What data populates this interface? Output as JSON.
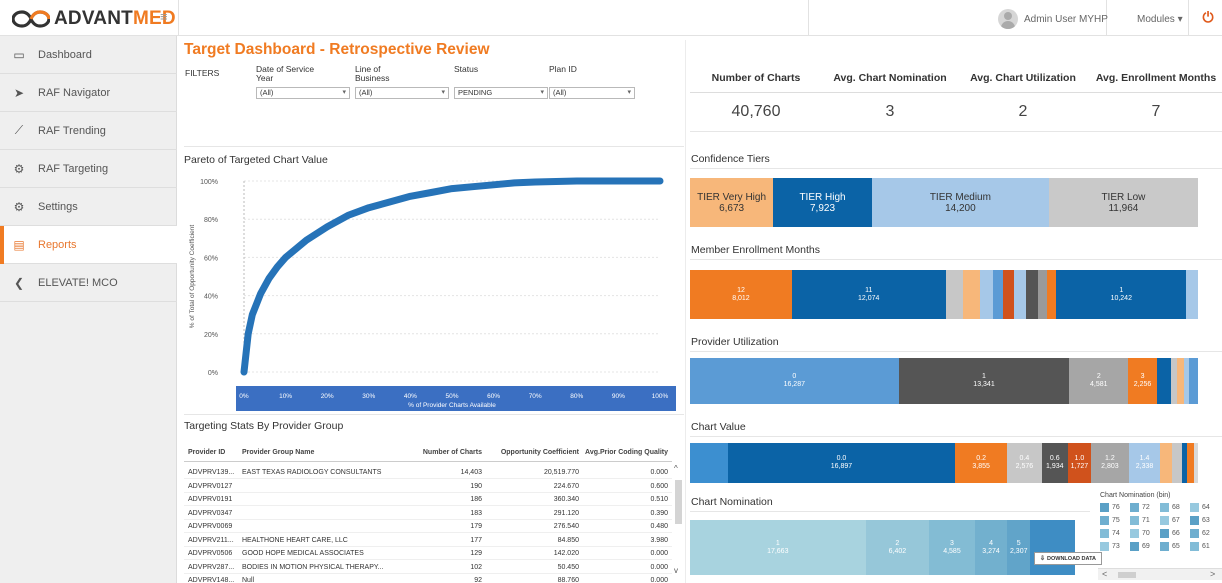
{
  "app": {
    "logo": {
      "prefix": "ADVANT",
      "accent": "MED"
    },
    "user": "Admin User MYHP",
    "modules": "Modules ▾"
  },
  "sidebar": {
    "items": [
      {
        "label": "Dashboard",
        "icon": "monitor-icon"
      },
      {
        "label": "RAF Navigator",
        "icon": "navigation-arrow-icon"
      },
      {
        "label": "RAF Trending",
        "icon": "trend-chart-icon"
      },
      {
        "label": "RAF Targeting",
        "icon": "target-gear-icon"
      },
      {
        "label": "Settings",
        "icon": "gears-icon"
      },
      {
        "label": "Reports",
        "icon": "document-icon",
        "active": true
      },
      {
        "label": "ELEVATE! MCO",
        "icon": "chevron-left-icon"
      }
    ]
  },
  "page": {
    "title": "Target Dashboard - Retrospective Review",
    "filters_label": "FILTERS",
    "filters": [
      {
        "label": "Date of Service Year",
        "value": "(All)"
      },
      {
        "label": "Line of Business",
        "value": "(All)"
      },
      {
        "label": "Status",
        "value": "PENDING"
      },
      {
        "label": "Plan ID",
        "value": "(All)"
      }
    ]
  },
  "kpis": [
    {
      "label": "Number of Charts",
      "value": "40,760"
    },
    {
      "label": "Avg. Chart Nomination",
      "value": "3"
    },
    {
      "label": "Avg. Chart Utilization",
      "value": "2"
    },
    {
      "label": "Avg. Enrollment Months",
      "value": "7"
    }
  ],
  "sections": {
    "pareto": "Pareto of Targeted Chart Value",
    "confidence": "Confidence Tiers",
    "enrollment": "Member Enrollment Months",
    "provider_util": "Provider Utilization",
    "chart_value": "Chart Value",
    "chart_nomination": "Chart Nomination",
    "targeting_stats": "Targeting Stats By Provider Group"
  },
  "colors": {
    "accent": "#f07b22",
    "blue_dark": "#0b63a6",
    "blue_mid": "#5b9bd5",
    "blue_light": "#a6c8e8",
    "gray": "#c7c7c7",
    "pareto_line": "#2673b8",
    "axis_band": "#3b6fc2"
  },
  "chart_data": {
    "type": "line",
    "title": "Pareto of Targeted Chart Value",
    "xlabel": "% of Provider Charts Available",
    "ylabel": "% of Total of Opportunity Coefficient",
    "x_ticks": [
      "0%",
      "10%",
      "20%",
      "30%",
      "40%",
      "50%",
      "60%",
      "70%",
      "80%",
      "90%",
      "100%"
    ],
    "y_ticks": [
      "0%",
      "20%",
      "40%",
      "60%",
      "80%",
      "100%"
    ],
    "xlim": [
      0,
      100
    ],
    "ylim": [
      0,
      100
    ],
    "x": [
      0,
      1,
      2,
      4,
      6,
      8,
      10,
      15,
      20,
      25,
      30,
      35,
      40,
      45,
      50,
      55,
      60,
      65,
      70,
      80,
      90,
      100
    ],
    "y": [
      0,
      20,
      30,
      41,
      49,
      55,
      60,
      69,
      76,
      82,
      86,
      89,
      92,
      94,
      96,
      97,
      98,
      99,
      99.5,
      100,
      100,
      100
    ]
  },
  "confidence_tiers": [
    {
      "label": "TIER Very High",
      "value": "6,673",
      "color": "#f7b77a",
      "dark": true,
      "w": 6673
    },
    {
      "label": "TIER High",
      "value": "7,923",
      "color": "#0b63a6",
      "dark": false,
      "w": 7923
    },
    {
      "label": "TIER Medium",
      "value": "14,200",
      "color": "#a6c8e8",
      "dark": true,
      "w": 14200
    },
    {
      "label": "TIER Low",
      "value": "11,964",
      "color": "#c9c9c9",
      "dark": true,
      "w": 11964
    }
  ],
  "enrollment_months": [
    {
      "label": "12",
      "value": "8,012",
      "color": "#f07b22",
      "w": 8012
    },
    {
      "label": "11",
      "value": "12,074",
      "color": "#0b63a6",
      "w": 12074
    },
    {
      "label": "",
      "value": "",
      "color": "#c7c7c7",
      "w": 1400
    },
    {
      "label": "",
      "value": "",
      "color": "#f7b77a",
      "w": 1300
    },
    {
      "label": "",
      "value": "",
      "color": "#a6c8e8",
      "w": 1000
    },
    {
      "label": "",
      "value": "",
      "color": "#5b9bd5",
      "w": 800
    },
    {
      "label": "",
      "value": "",
      "color": "#d0521c",
      "w": 900
    },
    {
      "label": "",
      "value": "",
      "color": "#a6c8e8",
      "w": 900
    },
    {
      "label": "",
      "value": "",
      "color": "#555555",
      "w": 1000
    },
    {
      "label": "",
      "value": "",
      "color": "#9a9a9a",
      "w": 700
    },
    {
      "label": "",
      "value": "",
      "color": "#f07b22",
      "w": 700
    },
    {
      "label": "1",
      "value": "10,242",
      "color": "#0b63a6",
      "w": 10242
    },
    {
      "label": "",
      "value": "",
      "color": "#a6c8e8",
      "w": 900
    }
  ],
  "provider_utilization": [
    {
      "label": "0",
      "value": "16,287",
      "color": "#5b9bd5",
      "w": 16287
    },
    {
      "label": "1",
      "value": "13,341",
      "color": "#555555",
      "w": 13341
    },
    {
      "label": "2",
      "value": "4,581",
      "color": "#a6a6a6",
      "w": 4581
    },
    {
      "label": "3",
      "value": "2,256",
      "color": "#f07b22",
      "w": 2256
    },
    {
      "label": "",
      "value": "",
      "color": "#0b63a6",
      "w": 1100
    },
    {
      "label": "",
      "value": "",
      "color": "#c7c7c7",
      "w": 500
    },
    {
      "label": "",
      "value": "",
      "color": "#f7b77a",
      "w": 500
    },
    {
      "label": "",
      "value": "",
      "color": "#a6c8e8",
      "w": 400
    },
    {
      "label": "",
      "value": "",
      "color": "#5b9bd5",
      "w": 700
    }
  ],
  "chart_value": [
    {
      "label": "",
      "value": "",
      "color": "#3c8fd0",
      "w": 2800
    },
    {
      "label": "0.0",
      "value": "16,897",
      "color": "#0b63a6",
      "w": 16897
    },
    {
      "label": "0.2",
      "value": "3,855",
      "color": "#f07b22",
      "w": 3855
    },
    {
      "label": "0.4",
      "value": "2,576",
      "color": "#c7c7c7",
      "w": 2576
    },
    {
      "label": "0.6",
      "value": "1,934",
      "color": "#555555",
      "w": 1934
    },
    {
      "label": "1.0",
      "value": "1,727",
      "color": "#d0521c",
      "w": 1727
    },
    {
      "label": "1.2",
      "value": "2,803",
      "color": "#a6a6a6",
      "w": 2803
    },
    {
      "label": "1.4",
      "value": "2,338",
      "color": "#a6c8e8",
      "w": 2338
    },
    {
      "label": "",
      "value": "",
      "color": "#f7b77a",
      "w": 900
    },
    {
      "label": "",
      "value": "",
      "color": "#c7c7c7",
      "w": 700
    },
    {
      "label": "",
      "value": "",
      "color": "#0b63a6",
      "w": 400
    },
    {
      "label": "",
      "value": "",
      "color": "#f07b22",
      "w": 500
    },
    {
      "label": "",
      "value": "",
      "color": "#d9d9d9",
      "w": 300
    }
  ],
  "chart_nomination": [
    {
      "label": "1",
      "value": "17,663",
      "color": "#a8d3df",
      "w": 17663
    },
    {
      "label": "2",
      "value": "6,402",
      "color": "#96c7d9",
      "w": 6402
    },
    {
      "label": "3",
      "value": "4,585",
      "color": "#83bcd4",
      "w": 4585
    },
    {
      "label": "4",
      "value": "3,274",
      "color": "#72b0ce",
      "w": 3274
    },
    {
      "label": "5",
      "value": "2,307",
      "color": "#61a4c9",
      "w": 2307
    },
    {
      "label": "",
      "value": "",
      "color": "#3e8dc4",
      "w": 4500
    }
  ],
  "nomination_legend": {
    "title": "Chart Nomination (bin)",
    "rows": [
      [
        "76",
        "72",
        "68",
        "64"
      ],
      [
        "75",
        "71",
        "67",
        "63"
      ],
      [
        "74",
        "70",
        "66",
        "62"
      ],
      [
        "73",
        "69",
        "65",
        "61"
      ]
    ]
  },
  "table": {
    "headers": [
      "Provider ID",
      "Provider Group Name",
      "Number of Charts",
      "Opportunity Coefficient",
      "Avg.Prior Coding Quality"
    ],
    "rows": [
      [
        "ADVPRV139...",
        "EAST TEXAS RADIOLOGY CONSULTANTS",
        "14,403",
        "20,519.770",
        "0.000"
      ],
      [
        "ADVPRV0127",
        "",
        "190",
        "224.670",
        "0.600"
      ],
      [
        "ADVPRV0191",
        "",
        "186",
        "360.340",
        "0.510"
      ],
      [
        "ADVPRV0347",
        "",
        "183",
        "291.120",
        "0.390"
      ],
      [
        "ADVPRV0069",
        "",
        "179",
        "276.540",
        "0.480"
      ],
      [
        "ADVPRV211...",
        "HEALTHONE HEART CARE, LLC",
        "177",
        "84.850",
        "3.980"
      ],
      [
        "ADVPRV0506",
        "GOOD HOPE MEDICAL ASSOCIATES",
        "129",
        "142.020",
        "0.000"
      ],
      [
        "ADVPRV287...",
        "BODIES IN MOTION PHYSICAL THERAPY...",
        "102",
        "50.450",
        "0.000"
      ],
      [
        "ADVPRV148...",
        "Null",
        "92",
        "88.760",
        "0.000"
      ]
    ]
  },
  "download_label": "DOWNLOAD DATA"
}
